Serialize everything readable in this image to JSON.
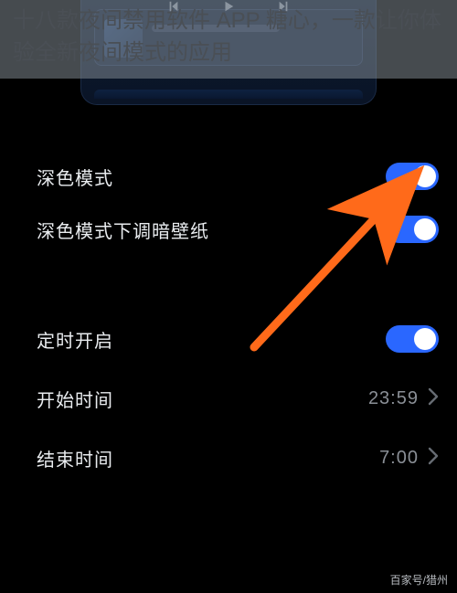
{
  "overlay": {
    "title": "十八款夜间禁用软件 APP 糖心，一款让你体验全新夜间模式的应用"
  },
  "settings": {
    "dark_mode": {
      "label": "深色模式",
      "enabled": true
    },
    "dim_wallpaper": {
      "label": "深色模式下调暗壁纸",
      "enabled": true
    },
    "scheduled": {
      "label": "定时开启",
      "enabled": true
    },
    "start_time": {
      "label": "开始时间",
      "value": "23:59"
    },
    "end_time": {
      "label": "结束时间",
      "value": "7:00"
    }
  },
  "colors": {
    "toggle_on": "#2a67ff",
    "annotation_arrow": "#ff6a1a"
  },
  "attribution": "百家号/猎州"
}
